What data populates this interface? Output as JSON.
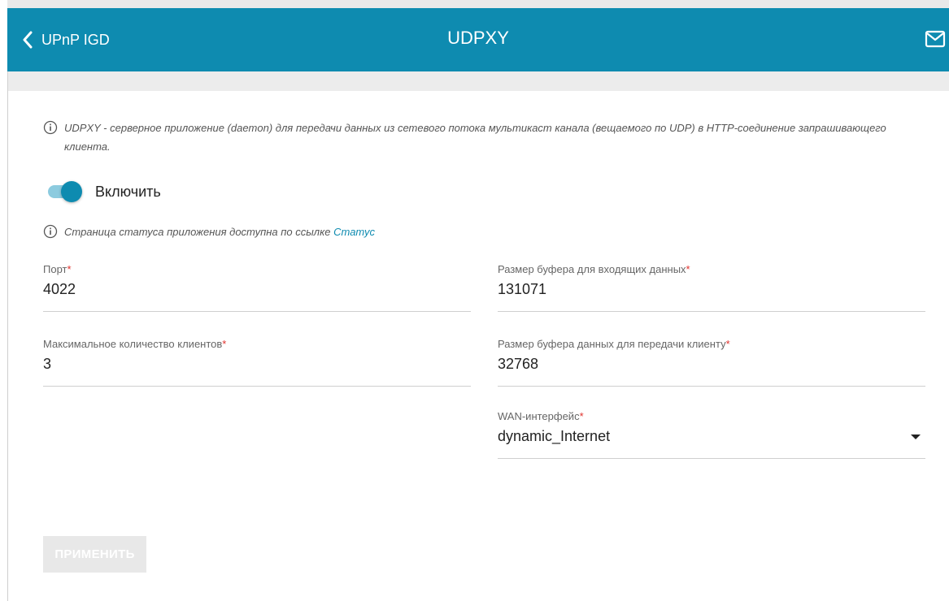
{
  "header": {
    "back_label": "UPnP IGD",
    "title": "UDPXY",
    "back_icon": "chevron-left-icon",
    "mail_icon": "mail-icon",
    "color": "#0e8bb0"
  },
  "info": {
    "description": "UDPXY - серверное приложение (daemon) для передачи данных из сетевого потока мультикаст канала (вещаемого по UDP) в HTTP-соединение запрашивающего клиента.",
    "status_text": "Страница статуса приложения доступна по ссылке ",
    "status_link": "Статус"
  },
  "toggle": {
    "label": "Включить",
    "enabled": true
  },
  "fields": {
    "port": {
      "label": "Порт",
      "required": "*",
      "value": "4022"
    },
    "max_clients": {
      "label": "Максимальное количество клиентов",
      "required": "*",
      "value": "3"
    },
    "buffer_in": {
      "label": "Размер буфера для входящих данных",
      "required": "*",
      "value": "131071"
    },
    "buffer_out": {
      "label": "Размер буфера данных для передачи клиенту",
      "required": "*",
      "value": "32768"
    },
    "wan": {
      "label": "WAN-интерфейс",
      "required": "*",
      "value": "dynamic_Internet"
    }
  },
  "actions": {
    "apply_label": "ПРИМЕНИТЬ",
    "apply_disabled": true
  }
}
